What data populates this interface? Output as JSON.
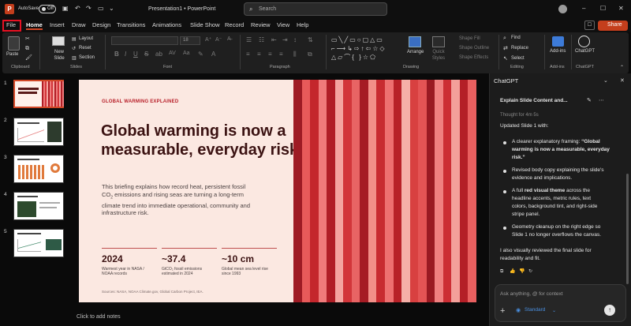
{
  "titlebar": {
    "autosave": "AutoSave",
    "autosave_state": "Off",
    "doc_title": "Presentation1 • PowerPoint",
    "search_placeholder": "Search",
    "share_label": "Share"
  },
  "tabs": [
    "File",
    "Home",
    "Insert",
    "Draw",
    "Design",
    "Transitions",
    "Animations",
    "Slide Show",
    "Record",
    "Review",
    "View",
    "Help"
  ],
  "ribbon": {
    "paste": "Paste",
    "new_slide": "New Slide",
    "layout": "Layout",
    "reset": "Reset",
    "section": "Section",
    "groups": {
      "clipboard": "Clipboard",
      "slides": "Slides",
      "font": "Font",
      "paragraph": "Paragraph",
      "drawing": "Drawing",
      "editing": "Editing",
      "addins": "Add-ins",
      "chatgpt": "ChatGPT"
    },
    "arrange": "Arrange",
    "quick_styles": "Quick Styles",
    "shape_fill": "Shape Fill",
    "shape_outline": "Shape Outline",
    "shape_effects": "Shape Effects",
    "find": "Find",
    "replace": "Replace",
    "select": "Select",
    "addins_btn": "Add-ins",
    "chatgpt_btn": "ChatGPT",
    "font_size": "18"
  },
  "thumbnails": [
    "1",
    "2",
    "3",
    "4",
    "5"
  ],
  "slide": {
    "kicker": "GLOBAL WARMING EXPLAINED",
    "title_line1": "Global warming is now a",
    "title_line2": "measurable, everyday risk",
    "body_l1": "This briefing explains how record heat, persistent fossil",
    "body_l2_pre": "CO",
    "body_l2_sub": "2",
    "body_l2_post": " emissions and rising seas are turning a long-term",
    "body_l3": "climate trend into immediate operational, community and",
    "body_l4": "infrastructure risk.",
    "metrics": [
      {
        "value": "2024",
        "cap1": "Warmest year in NASA /",
        "cap2": "NOAA records"
      },
      {
        "value": "~37.4",
        "cap1": "GtCO₂ fossil emissions",
        "cap2": "estimated in 2024"
      },
      {
        "value": "~10 cm",
        "cap1": "Global mean sea level rise",
        "cap2": "since 1993"
      }
    ],
    "sources": "Sources: NASA, NOAA Climate.gov, Global Carbon Project, IEA.",
    "stripe_colors": [
      "#9e1b24",
      "#e85a5a",
      "#c4262c",
      "#f07a7a",
      "#b01e26",
      "#f4a5a0",
      "#d2363a",
      "#e86464",
      "#a51c24",
      "#f28f88",
      "#c82b30",
      "#ee7070",
      "#b82228",
      "#f5b0a8",
      "#d84040",
      "#e45454",
      "#9a1a22",
      "#f08080",
      "#cc2e34",
      "#f3a09a",
      "#b41f27",
      "#e85f5f"
    ],
    "accent_color": "#b8202a"
  },
  "notes_placeholder": "Click to add notes",
  "chat": {
    "header": "ChatGPT",
    "thread_title": "Explain Slide Content and...",
    "thought": "Thought for 4m 5s",
    "updated": "Updated Slide 1 with:",
    "b1_l1_pre": "A clearer explanatory framing: ",
    "b1_l1_bold": "“Global",
    "b1_l2": "warming is now a measurable, everyday",
    "b1_l3": "risk.”",
    "b2_l1": "Revised body copy explaining the slide's",
    "b2_l2": "evidence and implications.",
    "b3_l1_pre": "A full ",
    "b3_l1_bold": "red visual theme",
    "b3_l1_post": " across the",
    "b3_l2": "headline accents, metric rules, text",
    "b3_l3": "colors, background tint, and right-side",
    "b3_l4": "stripe panel.",
    "b4_l1": "Geometry cleanup on the right edge so",
    "b4_l2": "Slide 1 no longer overflows the canvas.",
    "closing_l1": "I also visually reviewed the final slide for",
    "closing_l2": "readability and fit.",
    "input_placeholder": "Ask anything, @ for context",
    "mode": "Standard"
  }
}
